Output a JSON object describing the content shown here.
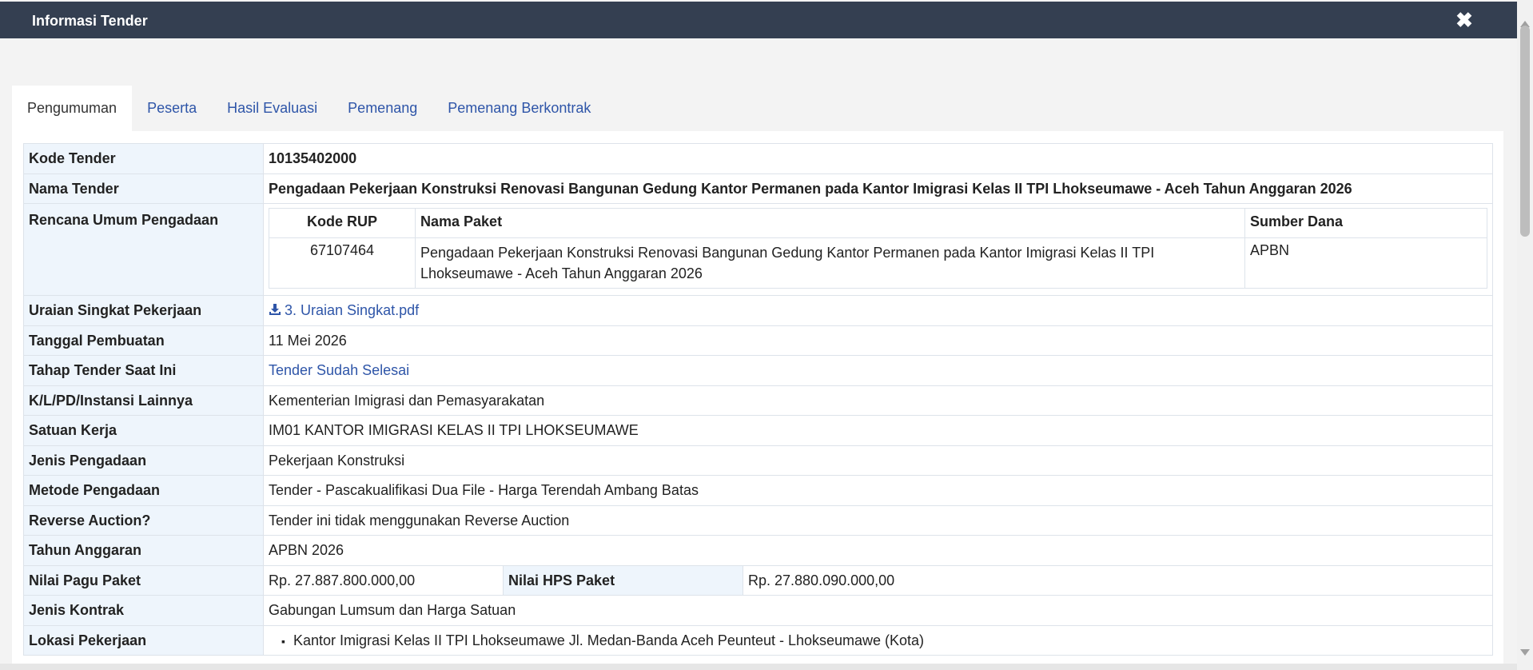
{
  "window": {
    "title": "Informasi Tender",
    "close_icon": "close-icon"
  },
  "tabs": [
    {
      "label": "Pengumuman",
      "active": true
    },
    {
      "label": "Peserta"
    },
    {
      "label": "Hasil Evaluasi"
    },
    {
      "label": "Pemenang"
    },
    {
      "label": "Pemenang Berkontrak"
    }
  ],
  "info": {
    "kode_tender": {
      "label": "Kode Tender",
      "value": "10135402000"
    },
    "nama_tender": {
      "label": "Nama Tender",
      "value": "Pengadaan Pekerjaan Konstruksi Renovasi Bangunan Gedung Kantor Permanen pada Kantor Imigrasi Kelas II TPI Lhokseumawe - Aceh Tahun Anggaran 2026"
    },
    "rup": {
      "label": "Rencana Umum Pengadaan",
      "headers": [
        "Kode RUP",
        "Nama Paket",
        "Sumber Dana"
      ],
      "rows": [
        {
          "kode": "67107464",
          "nama": "Pengadaan Pekerjaan Konstruksi Renovasi Bangunan Gedung Kantor Permanen pada Kantor Imigrasi Kelas II TPI Lhokseumawe - Aceh Tahun Anggaran 2026",
          "sumber": "APBN"
        }
      ]
    },
    "uraian": {
      "label": "Uraian Singkat Pekerjaan",
      "file": "3. Uraian Singkat.pdf",
      "icon": "download-icon"
    },
    "tanggal": {
      "label": "Tanggal Pembuatan",
      "value": "11 Mei 2026"
    },
    "tahap": {
      "label": "Tahap Tender Saat Ini",
      "value": "Tender Sudah Selesai"
    },
    "klpd": {
      "label": "K/L/PD/Instansi Lainnya",
      "value": "Kementerian Imigrasi dan Pemasyarakatan"
    },
    "satker": {
      "label": "Satuan Kerja",
      "value": "IM01 KANTOR IMIGRASI KELAS II TPI LHOKSEUMAWE"
    },
    "jenis": {
      "label": "Jenis Pengadaan",
      "value": "Pekerjaan Konstruksi"
    },
    "metode": {
      "label": "Metode Pengadaan",
      "value": "Tender - Pascakualifikasi Dua File - Harga Terendah Ambang Batas"
    },
    "reverse": {
      "label": "Reverse Auction?",
      "value": "Tender ini tidak menggunakan Reverse Auction"
    },
    "tahun": {
      "label": "Tahun Anggaran",
      "value": "APBN 2026"
    },
    "pagu": {
      "label": "Nilai Pagu Paket",
      "value": "Rp. 27.887.800.000,00"
    },
    "hps": {
      "label": "Nilai HPS Paket",
      "value": "Rp. 27.880.090.000,00"
    },
    "kontrak": {
      "label": "Jenis Kontrak",
      "value": "Gabungan Lumsum dan Harga Satuan"
    },
    "lokasi": {
      "label": "Lokasi Pekerjaan",
      "items": [
        "Kantor Imigrasi Kelas II TPI Lhokseumawe Jl. Medan-Banda Aceh Peunteut - Lhokseumawe (Kota)"
      ]
    }
  }
}
